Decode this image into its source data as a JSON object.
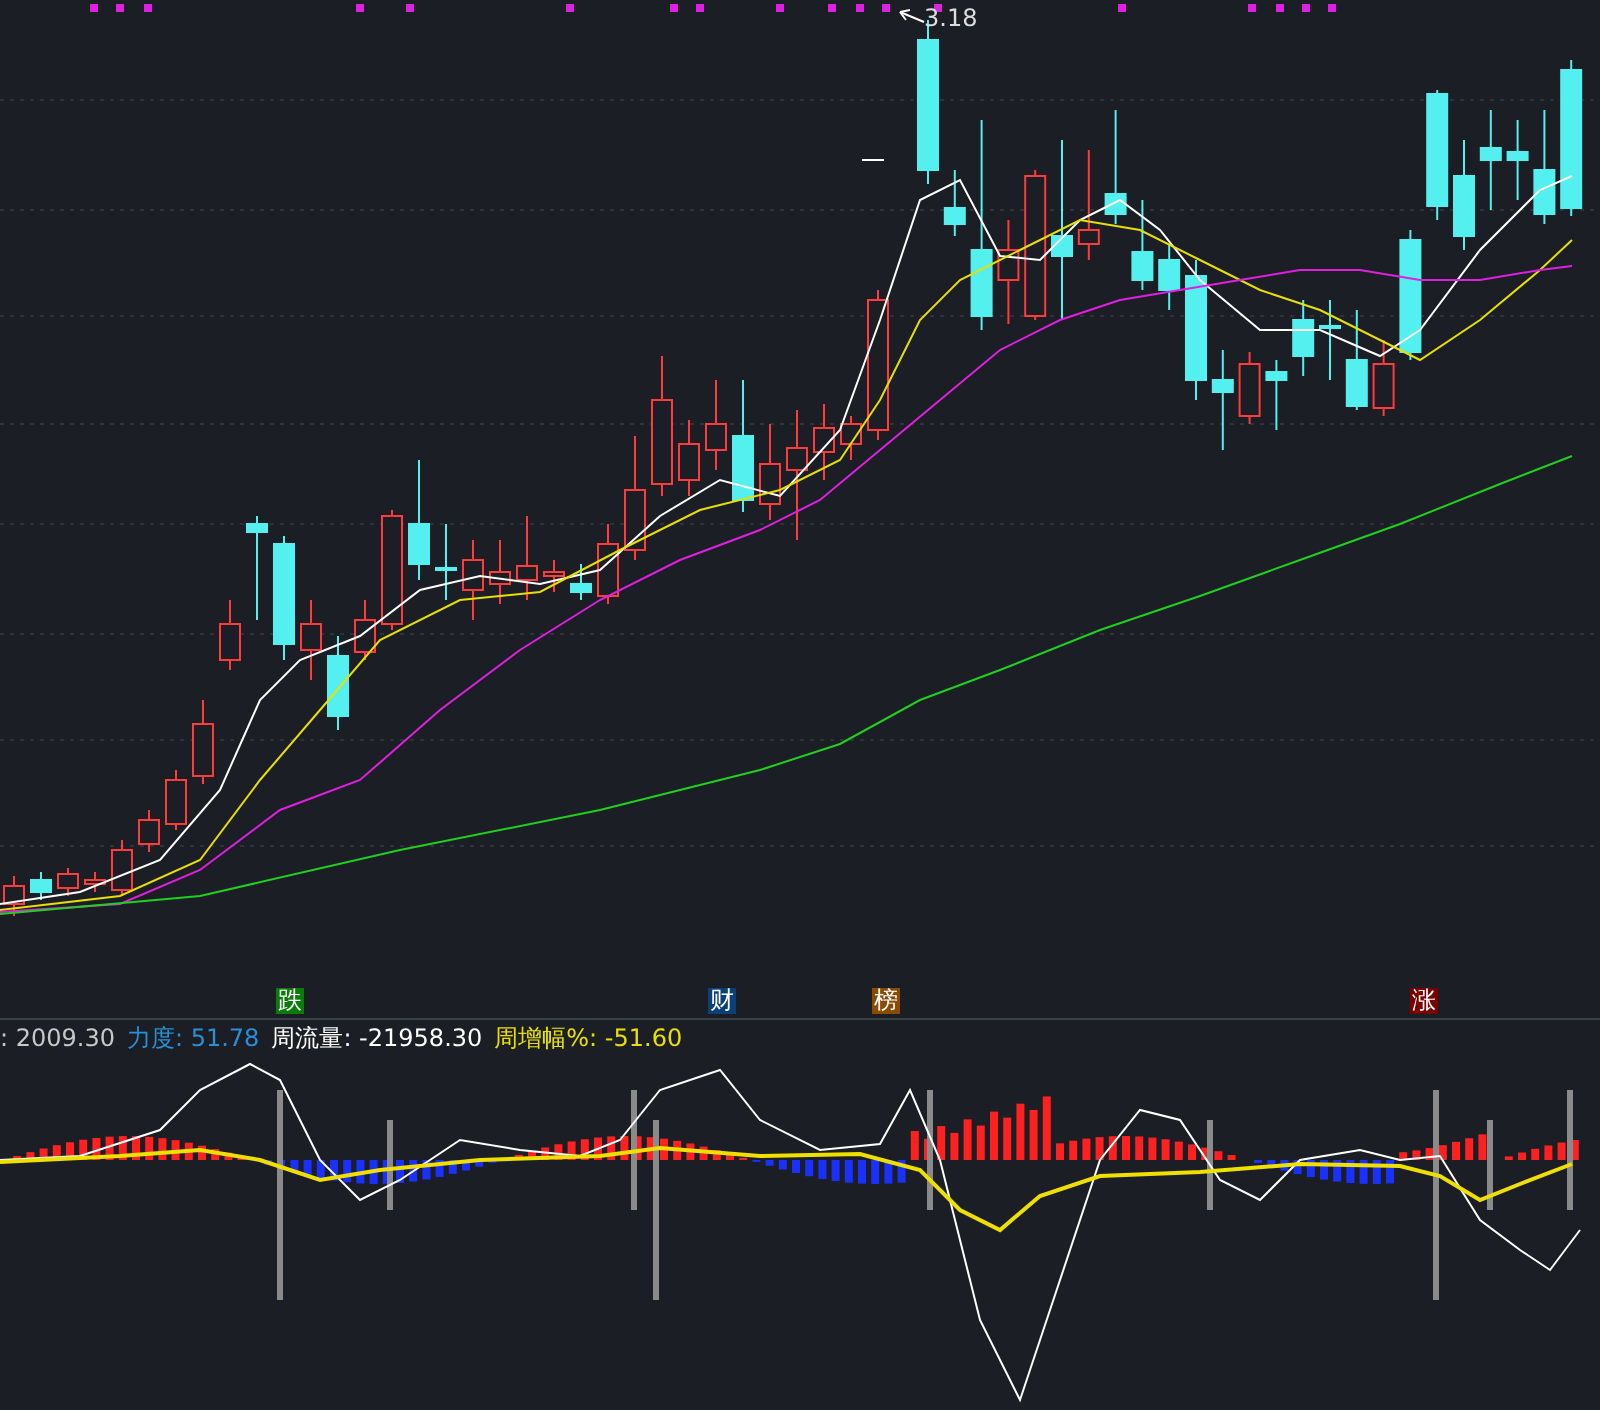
{
  "price_chart": {
    "peak_label": "3.18",
    "signals": [
      {
        "text": "跌",
        "color": "#0a7a0a"
      },
      {
        "text": "财",
        "color": "#0a3f7a"
      },
      {
        "text": "榜",
        "color": "#8a4a00"
      },
      {
        "text": "涨",
        "color": "#7a0000"
      }
    ]
  },
  "indicator": {
    "readings": [
      {
        "text": ": 2009.30",
        "color": "#c8c8c8"
      },
      {
        "text": "力度: 51.78",
        "color": "#2a8fd6"
      },
      {
        "text": "周流量: -21958.30",
        "color": "#ffffff"
      },
      {
        "text": "周增幅%: -51.60",
        "color": "#e8e000"
      }
    ]
  }
}
